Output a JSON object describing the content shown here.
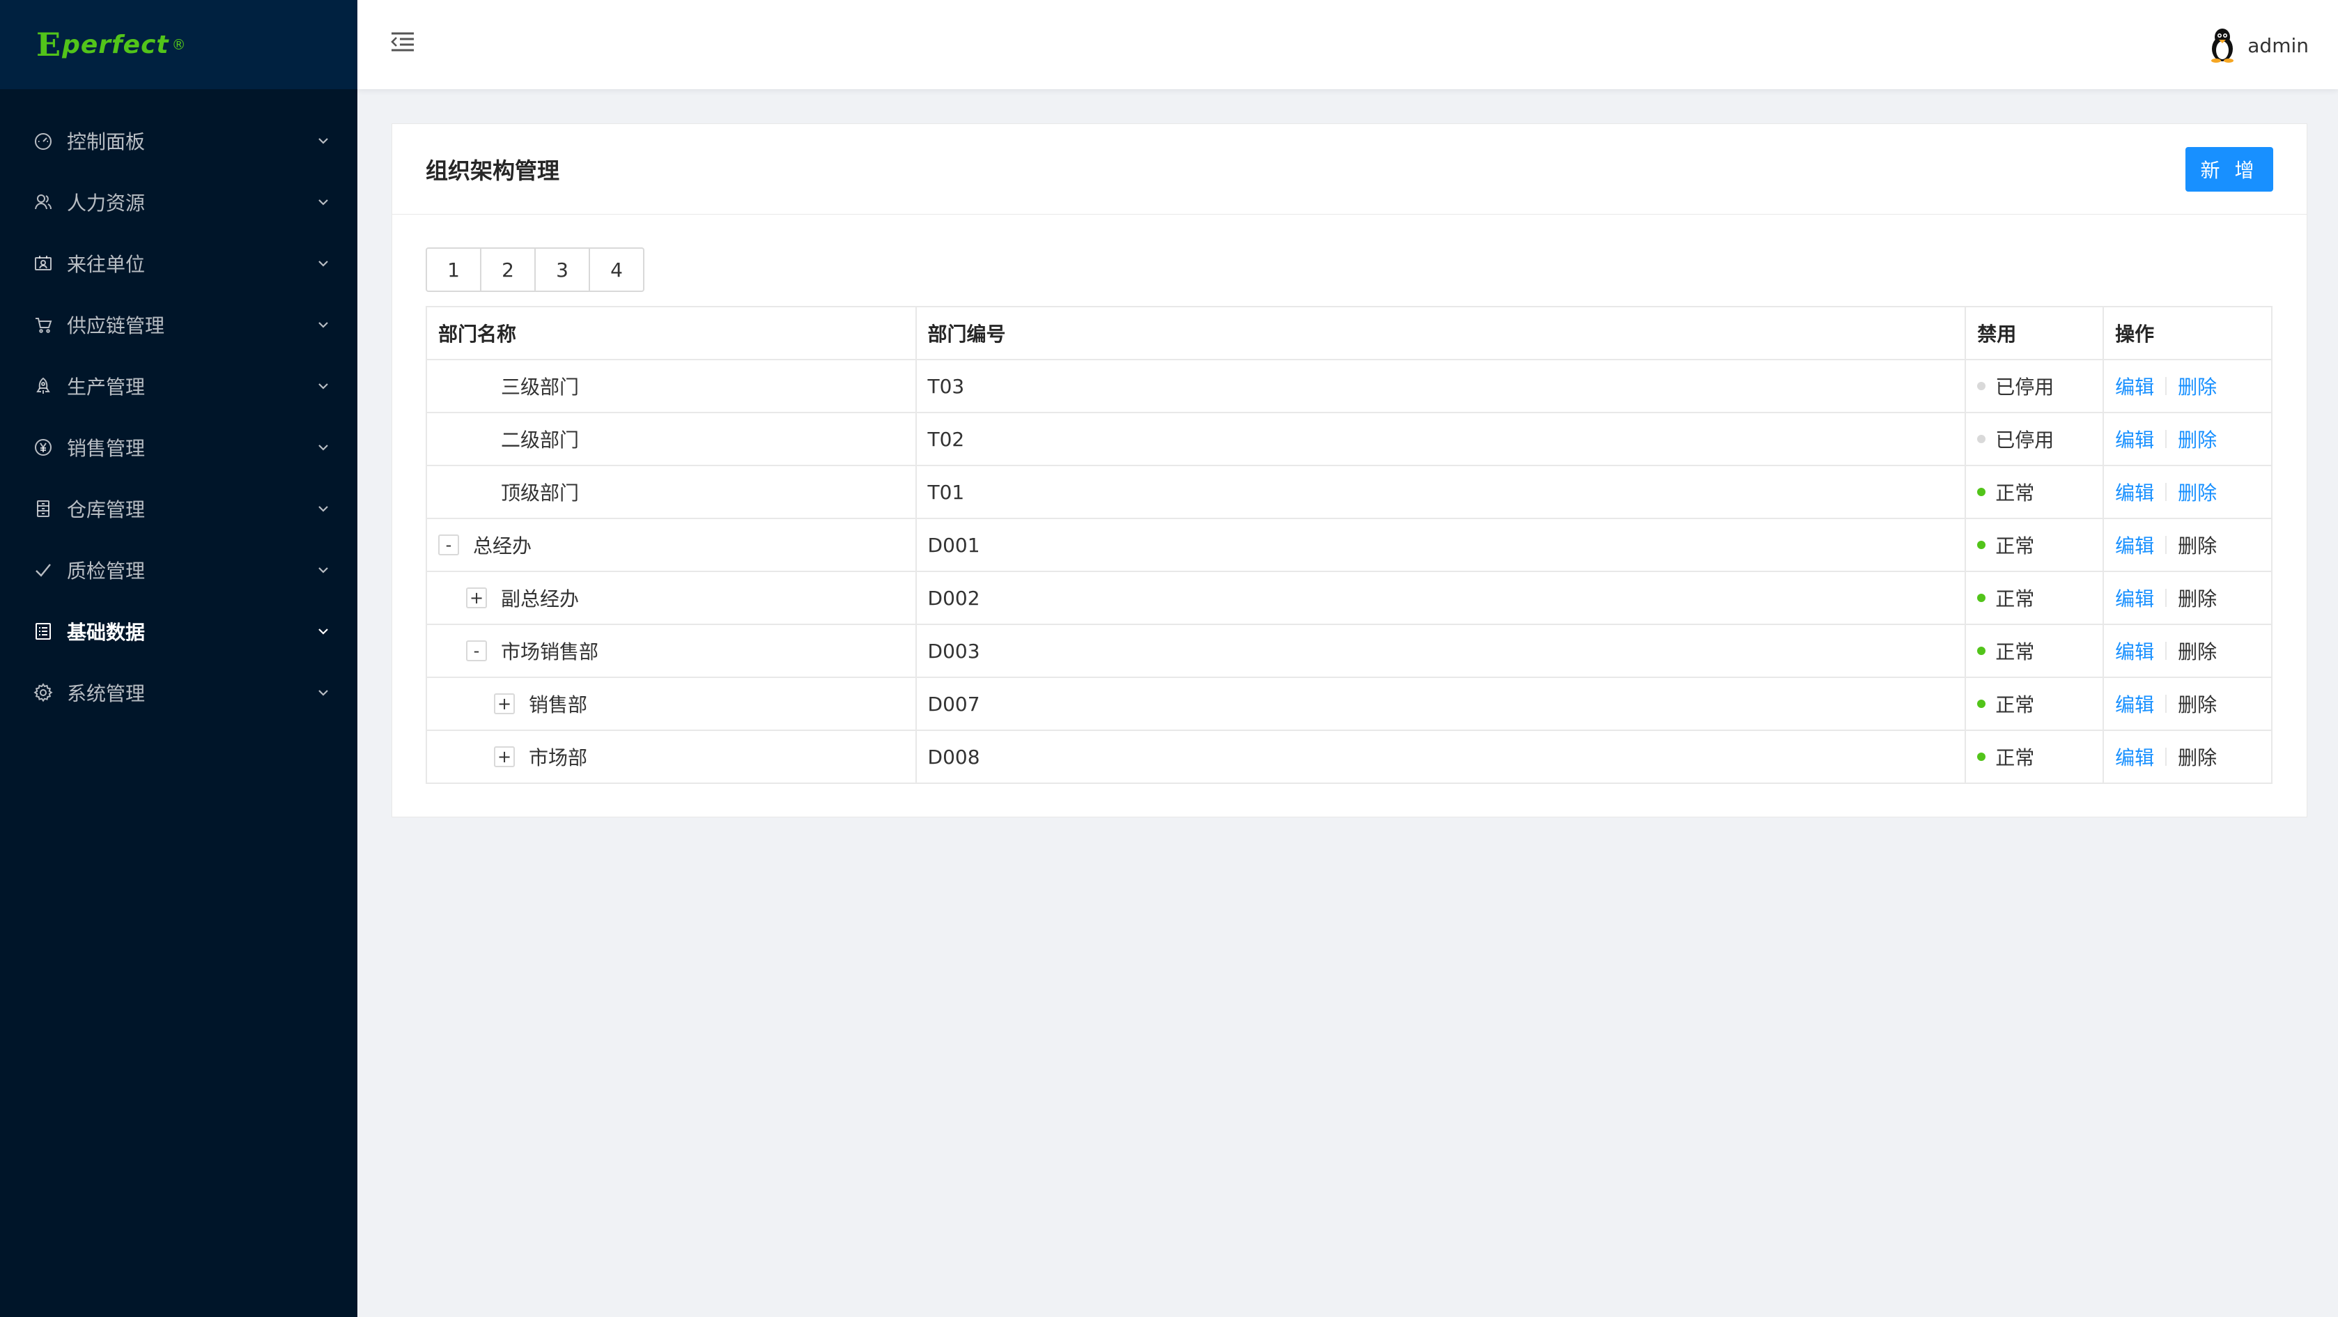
{
  "brand": {
    "logo_mark": "E",
    "logo_text": "perfect",
    "logo_reg": "®",
    "color": "#52c41a"
  },
  "sidebar": {
    "items": [
      {
        "label": "控制面板",
        "icon": "dashboard-icon",
        "active": false
      },
      {
        "label": "人力资源",
        "icon": "people-icon",
        "active": false
      },
      {
        "label": "来往单位",
        "icon": "contact-card-icon",
        "active": false
      },
      {
        "label": "供应链管理",
        "icon": "cart-icon",
        "active": false
      },
      {
        "label": "生产管理",
        "icon": "rocket-icon",
        "active": false
      },
      {
        "label": "销售管理",
        "icon": "yen-icon",
        "active": false
      },
      {
        "label": "仓库管理",
        "icon": "warehouse-icon",
        "active": false
      },
      {
        "label": "质检管理",
        "icon": "check-icon",
        "active": false
      },
      {
        "label": "基础数据",
        "icon": "data-list-icon",
        "active": true
      },
      {
        "label": "系统管理",
        "icon": "gear-icon",
        "active": false
      }
    ]
  },
  "header": {
    "username": "admin",
    "avatar_icon": "penguin-avatar-icon",
    "collapse_icon": "menu-fold-icon"
  },
  "main": {
    "title": "组织架构管理",
    "add_label": "新 增",
    "pages": [
      "1",
      "2",
      "3",
      "4"
    ],
    "table": {
      "headers": [
        "部门名称",
        "部门编号",
        "禁用",
        "操作"
      ],
      "rows": [
        {
          "name": "三级部门",
          "code": "T03",
          "status": "已停用",
          "enabled": false,
          "level": 1,
          "toggle": "",
          "edit": "编辑",
          "delete": "删除",
          "delete_linked": true
        },
        {
          "name": "二级部门",
          "code": "T02",
          "status": "已停用",
          "enabled": false,
          "level": 1,
          "toggle": "",
          "edit": "编辑",
          "delete": "删除",
          "delete_linked": true
        },
        {
          "name": "顶级部门",
          "code": "T01",
          "status": "正常",
          "enabled": true,
          "level": 1,
          "toggle": "",
          "edit": "编辑",
          "delete": "删除",
          "delete_linked": true
        },
        {
          "name": "总经办",
          "code": "D001",
          "status": "正常",
          "enabled": true,
          "level": 0,
          "toggle": "-",
          "edit": "编辑",
          "delete": "删除",
          "delete_linked": false
        },
        {
          "name": "副总经办",
          "code": "D002",
          "status": "正常",
          "enabled": true,
          "level": 1,
          "toggle": "+",
          "edit": "编辑",
          "delete": "删除",
          "delete_linked": false
        },
        {
          "name": "市场销售部",
          "code": "D003",
          "status": "正常",
          "enabled": true,
          "level": 1,
          "toggle": "-",
          "edit": "编辑",
          "delete": "删除",
          "delete_linked": false
        },
        {
          "name": "销售部",
          "code": "D007",
          "status": "正常",
          "enabled": true,
          "level": 2,
          "toggle": "+",
          "edit": "编辑",
          "delete": "删除",
          "delete_linked": false
        },
        {
          "name": "市场部",
          "code": "D008",
          "status": "正常",
          "enabled": true,
          "level": 2,
          "toggle": "+",
          "edit": "编辑",
          "delete": "删除",
          "delete_linked": false
        }
      ]
    }
  },
  "colors": {
    "primary": "#1890ff",
    "sidebar_bg": "#001529",
    "status_ok": "#52c41a",
    "status_off": "#d9d9d9"
  }
}
